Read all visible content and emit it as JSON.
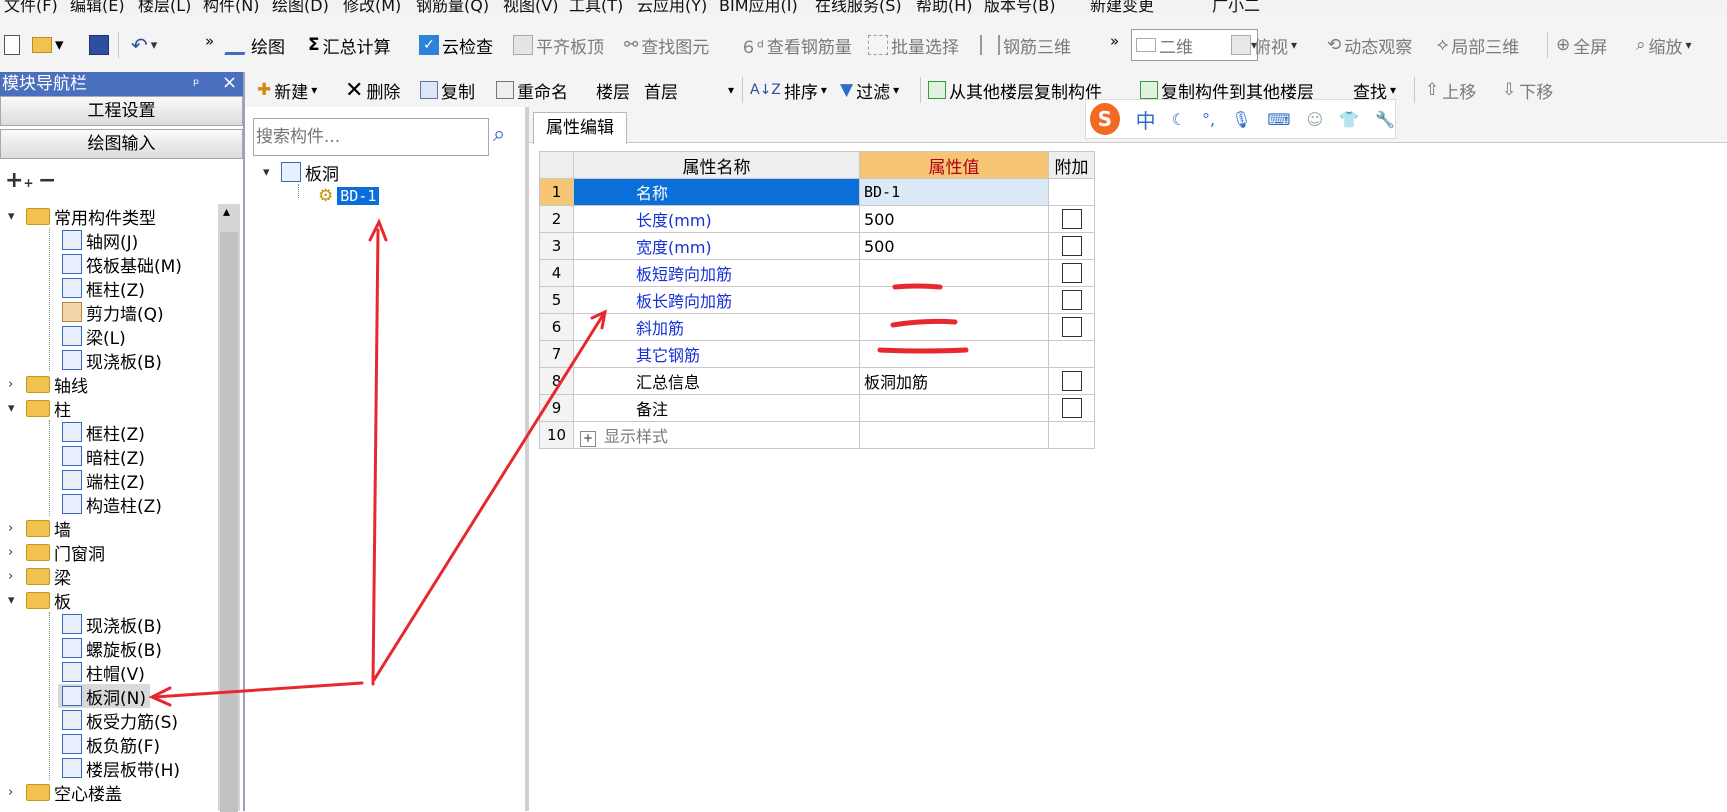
{
  "menubar": [
    "文件(F)",
    "编辑(E)",
    "楼层(L)",
    "构件(N)",
    "绘图(D)",
    "修改(M)",
    "钢筋量(Q)",
    "视图(V)",
    "工具(T)",
    "云应用(Y)",
    "BIM应用(I)",
    "在线服务(S)",
    "帮助(H)",
    "版本号(B)",
    "新建变更",
    "广小二"
  ],
  "toolbar1": {
    "more": "»",
    "draw": "绘图",
    "calc": "汇总计算",
    "cloud_check": "云检查",
    "flat_top": "平齐板顶",
    "find_elem": "查找图元",
    "view_rebar": "查看钢筋量",
    "batch_select": "批量选择",
    "rebar_3d": "钢筋三维",
    "view_mode": "二维",
    "top_view": "俯视",
    "dynamic_view": "动态观察",
    "local_3d": "局部三维",
    "full_screen": "全屏",
    "zoom": "缩放"
  },
  "nav": {
    "title": "模块导航栏",
    "pin": "ᵖ",
    "close": "×",
    "project_settings": "工程设置",
    "draw_input": "绘图输入",
    "expand": "+",
    "collapse": "−",
    "tree": [
      "常用构件类型",
      "轴网(J)",
      "筏板基础(M)",
      "框柱(Z)",
      "剪力墙(Q)",
      "梁(L)",
      "现浇板(B)",
      "轴线",
      "柱",
      "框柱(Z)",
      "暗柱(Z)",
      "端柱(Z)",
      "构造柱(Z)",
      "墙",
      "门窗洞",
      "梁",
      "板",
      "现浇板(B)",
      "螺旋板(B)",
      "柱帽(V)",
      "板洞(N)",
      "板受力筋(S)",
      "板负筋(F)",
      "楼层板带(H)",
      "空心楼盖"
    ]
  },
  "toolbar2": {
    "new": "新建",
    "delete": "删除",
    "copy": "复制",
    "rename": "重命名",
    "floor_label": "楼层",
    "floor_value": "首层",
    "sort": "排序",
    "filter": "过滤",
    "copy_from": "从其他楼层复制构件",
    "copy_to": "复制构件到其他楼层",
    "find": "查找",
    "move_up": "上移",
    "move_down": "下移"
  },
  "component": {
    "search_placeholder": "搜索构件...",
    "root": "板洞",
    "child": "BD-1"
  },
  "props": {
    "tab": "属性编辑",
    "headers": [
      "属性名称",
      "属性值",
      "附加"
    ],
    "rows": [
      {
        "n": "1",
        "name": "名称",
        "value": "BD-1"
      },
      {
        "n": "2",
        "name": "长度(mm)",
        "value": "500"
      },
      {
        "n": "3",
        "name": "宽度(mm)",
        "value": "500"
      },
      {
        "n": "4",
        "name": "板短跨向加筋",
        "value": ""
      },
      {
        "n": "5",
        "name": "板长跨向加筋",
        "value": ""
      },
      {
        "n": "6",
        "name": "斜加筋",
        "value": ""
      },
      {
        "n": "7",
        "name": "其它钢筋",
        "value": ""
      },
      {
        "n": "8",
        "name": "汇总信息",
        "value": "板洞加筋"
      },
      {
        "n": "9",
        "name": "备注",
        "value": ""
      },
      {
        "n": "10",
        "name": "显示样式",
        "value": ""
      }
    ],
    "expander": "+"
  },
  "ime": {
    "logo": "S",
    "lang": "中"
  },
  "colors": {
    "nav_title": "#4a6fbe",
    "selection": "#0a6fd8",
    "header_value": "#f6c675",
    "annotation": "#e8282f",
    "link_text": "#1530d8"
  }
}
